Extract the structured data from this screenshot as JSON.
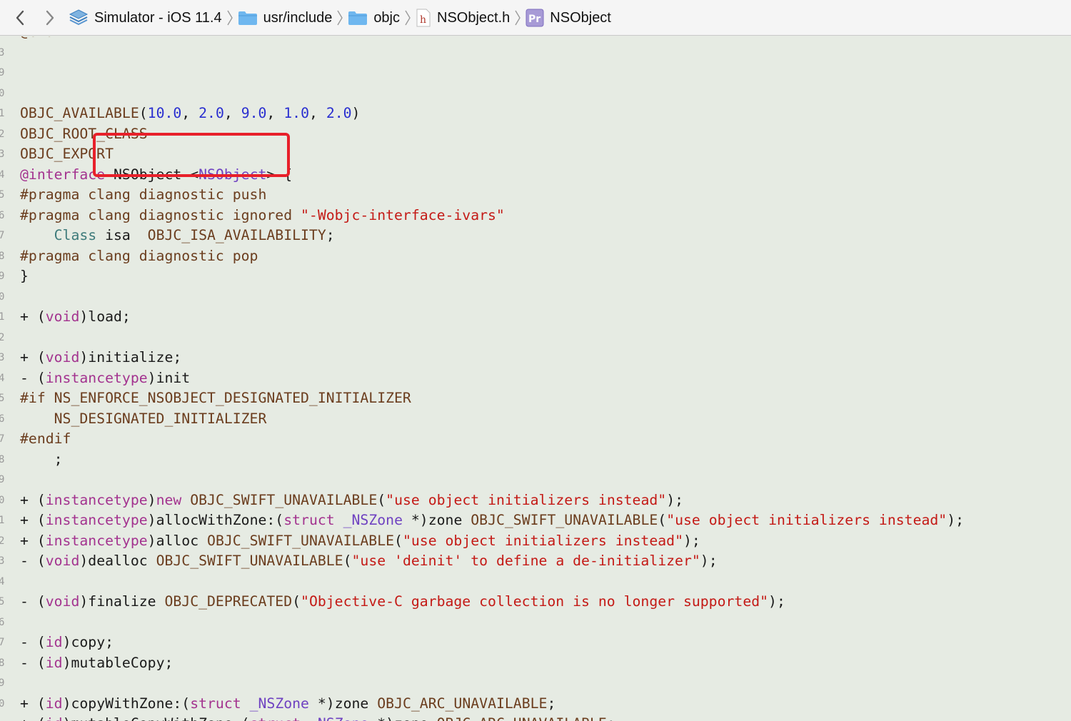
{
  "nav": {
    "back": "back",
    "forward": "forward"
  },
  "breadcrumbs": [
    {
      "label": "Simulator - iOS 11.4",
      "icon": "sdk-icon"
    },
    {
      "label": "usr/include",
      "icon": "folder-icon"
    },
    {
      "label": "objc",
      "icon": "folder-icon"
    },
    {
      "label": "NSObject.h",
      "icon": "header-file-icon"
    },
    {
      "label": "NSObject",
      "icon": "protocol-icon"
    }
  ],
  "gutter": [
    "3",
    "9",
    "0",
    "1",
    "2",
    "3",
    "4",
    "5",
    "6",
    "7",
    "8",
    "9",
    "0",
    "1",
    "2",
    "3",
    "4",
    "5",
    "6",
    "7",
    "8",
    "9",
    "0",
    "1",
    "2",
    "3",
    "4",
    "5",
    "6",
    "7",
    "8",
    "9",
    "0"
  ],
  "colors": {
    "highlight_box": "#e8202a",
    "editor_bg": "#e6ebe3"
  },
  "code_lines": [
    [
      [
        "pp",
        "@end"
      ]
    ],
    [],
    [],
    [],
    [
      [
        "mac",
        "OBJC_AVAILABLE"
      ],
      [
        "plain",
        "("
      ],
      [
        "num",
        "10.0"
      ],
      [
        "plain",
        ", "
      ],
      [
        "num",
        "2.0"
      ],
      [
        "plain",
        ", "
      ],
      [
        "num",
        "9.0"
      ],
      [
        "plain",
        ", "
      ],
      [
        "num",
        "1.0"
      ],
      [
        "plain",
        ", "
      ],
      [
        "num",
        "2.0"
      ],
      [
        "plain",
        ")"
      ]
    ],
    [
      [
        "mac",
        "OBJC_ROOT_CLASS"
      ]
    ],
    [
      [
        "mac",
        "OBJC_EXPORT"
      ]
    ],
    [
      [
        "kw",
        "@interface"
      ],
      [
        "plain",
        " NSObject <"
      ],
      [
        "typ",
        "NSObject"
      ],
      [
        "plain",
        "> {"
      ]
    ],
    [
      [
        "pp",
        "#pragma clang diagnostic push"
      ]
    ],
    [
      [
        "pp",
        "#pragma clang diagnostic ignored "
      ],
      [
        "str",
        "\"-Wobjc-interface-ivars\""
      ]
    ],
    [
      [
        "plain",
        "    "
      ],
      [
        "cls",
        "Class"
      ],
      [
        "plain",
        " isa  "
      ],
      [
        "mac",
        "OBJC_ISA_AVAILABILITY"
      ],
      [
        "plain",
        ";"
      ]
    ],
    [
      [
        "pp",
        "#pragma clang diagnostic pop"
      ]
    ],
    [
      [
        "plain",
        "}"
      ]
    ],
    [],
    [
      [
        "plain",
        "+ ("
      ],
      [
        "kw",
        "void"
      ],
      [
        "plain",
        ")load;"
      ]
    ],
    [],
    [
      [
        "plain",
        "+ ("
      ],
      [
        "kw",
        "void"
      ],
      [
        "plain",
        ")initialize;"
      ]
    ],
    [
      [
        "plain",
        "- ("
      ],
      [
        "kw",
        "instancetype"
      ],
      [
        "plain",
        ")init"
      ]
    ],
    [
      [
        "pp",
        "#if "
      ],
      [
        "mac",
        "NS_ENFORCE_NSOBJECT_DESIGNATED_INITIALIZER"
      ]
    ],
    [
      [
        "plain",
        "    "
      ],
      [
        "mac",
        "NS_DESIGNATED_INITIALIZER"
      ]
    ],
    [
      [
        "pp",
        "#endif"
      ]
    ],
    [
      [
        "plain",
        "    ;"
      ]
    ],
    [],
    [
      [
        "plain",
        "+ ("
      ],
      [
        "kw",
        "instancetype"
      ],
      [
        "plain",
        ")"
      ],
      [
        "kw",
        "new"
      ],
      [
        "plain",
        " "
      ],
      [
        "mac",
        "OBJC_SWIFT_UNAVAILABLE"
      ],
      [
        "plain",
        "("
      ],
      [
        "str",
        "\"use object initializers instead\""
      ],
      [
        "plain",
        ");"
      ]
    ],
    [
      [
        "plain",
        "+ ("
      ],
      [
        "kw",
        "instancetype"
      ],
      [
        "plain",
        ")allocWithZone:("
      ],
      [
        "kw",
        "struct"
      ],
      [
        "plain",
        " "
      ],
      [
        "typ",
        "_NSZone"
      ],
      [
        "plain",
        " *)zone "
      ],
      [
        "mac",
        "OBJC_SWIFT_UNAVAILABLE"
      ],
      [
        "plain",
        "("
      ],
      [
        "str",
        "\"use object initializers instead\""
      ],
      [
        "plain",
        ");"
      ]
    ],
    [
      [
        "plain",
        "+ ("
      ],
      [
        "kw",
        "instancetype"
      ],
      [
        "plain",
        ")alloc "
      ],
      [
        "mac",
        "OBJC_SWIFT_UNAVAILABLE"
      ],
      [
        "plain",
        "("
      ],
      [
        "str",
        "\"use object initializers instead\""
      ],
      [
        "plain",
        ");"
      ]
    ],
    [
      [
        "plain",
        "- ("
      ],
      [
        "kw",
        "void"
      ],
      [
        "plain",
        ")dealloc "
      ],
      [
        "mac",
        "OBJC_SWIFT_UNAVAILABLE"
      ],
      [
        "plain",
        "("
      ],
      [
        "str",
        "\"use 'deinit' to define a de-initializer\""
      ],
      [
        "plain",
        ");"
      ]
    ],
    [],
    [
      [
        "plain",
        "- ("
      ],
      [
        "kw",
        "void"
      ],
      [
        "plain",
        ")finalize "
      ],
      [
        "mac",
        "OBJC_DEPRECATED"
      ],
      [
        "plain",
        "("
      ],
      [
        "str",
        "\"Objective-C garbage collection is no longer supported\""
      ],
      [
        "plain",
        ");"
      ]
    ],
    [],
    [
      [
        "plain",
        "- ("
      ],
      [
        "kw",
        "id"
      ],
      [
        "plain",
        ")copy;"
      ]
    ],
    [
      [
        "plain",
        "- ("
      ],
      [
        "kw",
        "id"
      ],
      [
        "plain",
        ")mutableCopy;"
      ]
    ],
    [],
    [
      [
        "plain",
        "+ ("
      ],
      [
        "kw",
        "id"
      ],
      [
        "plain",
        ")copyWithZone:("
      ],
      [
        "kw",
        "struct"
      ],
      [
        "plain",
        " "
      ],
      [
        "typ",
        "_NSZone"
      ],
      [
        "plain",
        " *)zone "
      ],
      [
        "mac",
        "OBJC_ARC_UNAVAILABLE"
      ],
      [
        "plain",
        ";"
      ]
    ],
    [
      [
        "plain",
        "+ ("
      ],
      [
        "kw",
        "id"
      ],
      [
        "plain",
        ")mutableCopyWithZone:("
      ],
      [
        "kw",
        "struct"
      ],
      [
        "plain",
        " "
      ],
      [
        "typ",
        "_NSZone"
      ],
      [
        "plain",
        " *)zone "
      ],
      [
        "mac",
        "OBJC_ARC_UNAVAILABLE"
      ],
      [
        "plain",
        ";"
      ]
    ]
  ]
}
